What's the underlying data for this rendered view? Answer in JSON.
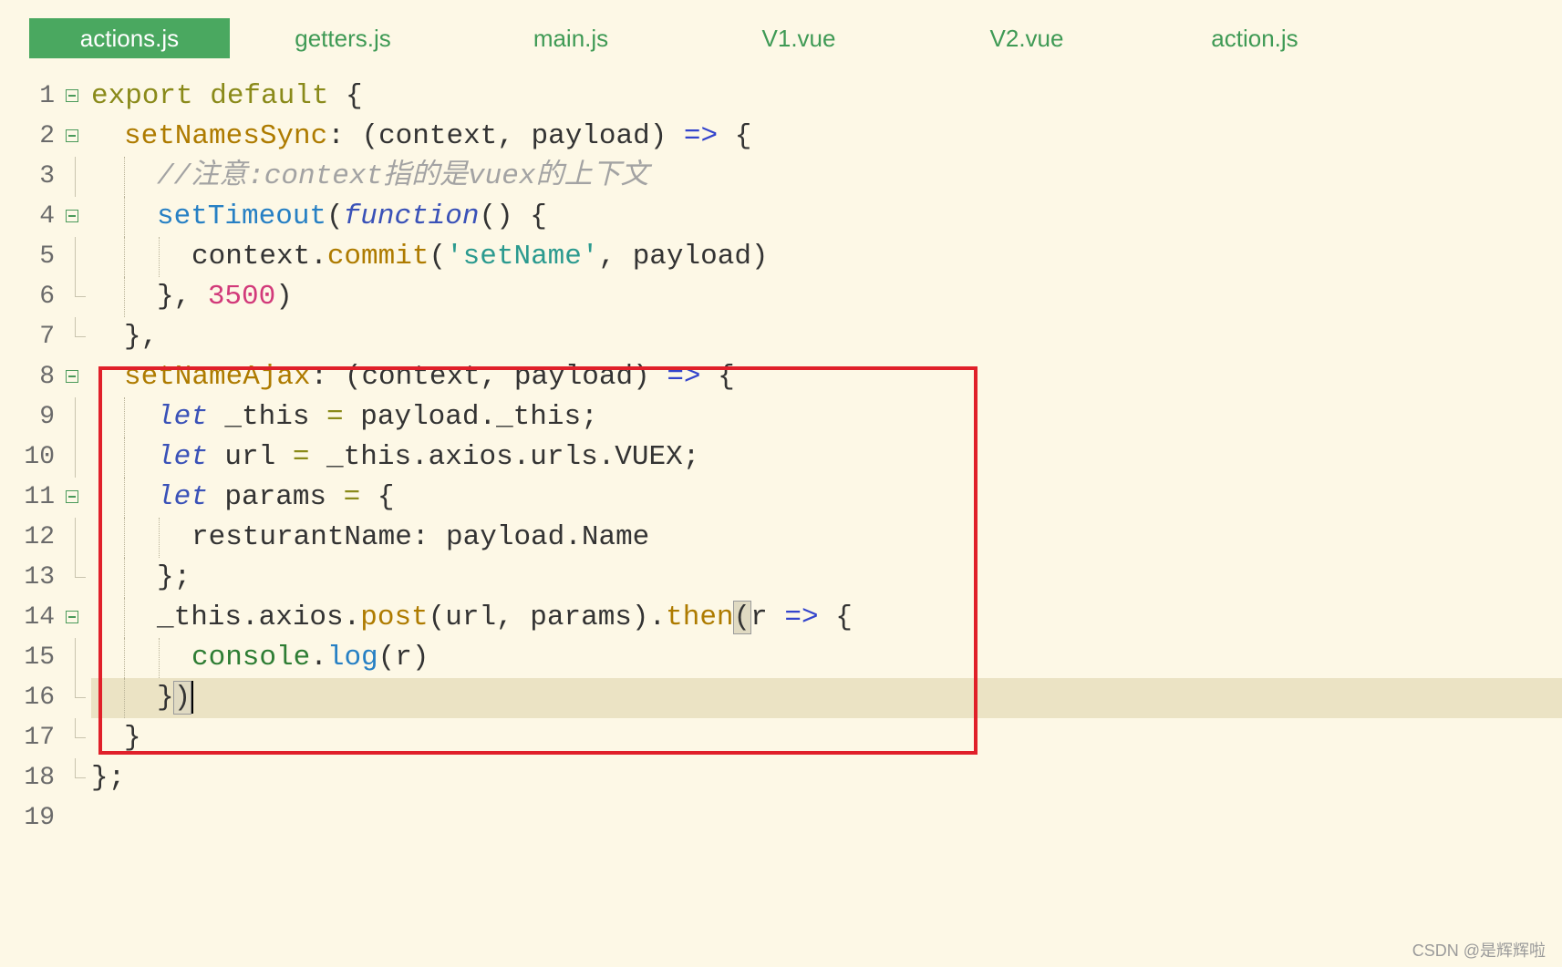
{
  "tabs": [
    {
      "label": "actions.js",
      "active": true
    },
    {
      "label": "getters.js"
    },
    {
      "label": "main.js"
    },
    {
      "label": "V1.vue"
    },
    {
      "label": "V2.vue"
    },
    {
      "label": "action.js"
    }
  ],
  "lines": {
    "n1": "1",
    "n2": "2",
    "n3": "3",
    "n4": "4",
    "n5": "5",
    "n6": "6",
    "n7": "7",
    "n8": "8",
    "n9": "9",
    "n10": "10",
    "n11": "11",
    "n12": "12",
    "n13": "13",
    "n14": "14",
    "n15": "15",
    "n16": "16",
    "n17": "17",
    "n18": "18",
    "n19": "19"
  },
  "tokens": {
    "export_default": "export default",
    "open_brace": " {",
    "setNamesSync": "setNamesSync",
    "colon": ":",
    "context_payload": " (context, payload) ",
    "arrow": "=>",
    "comment": "//注意:context指的是vuex的上下文",
    "setTimeout": "setTimeout",
    "paren_open": "(",
    "function": "function",
    "paren_close_brace": "() {",
    "context_dot": "context.",
    "commit": "commit",
    "str_setName": "'setName'",
    "comma_payload_close": ", payload)",
    "close_comma": "}, ",
    "num_3500": "3500",
    "paren_close": ")",
    "close_brace_comma": "},",
    "setNameAjax": "setNameAjax",
    "let": "let",
    "this_assign": " _this ",
    "eq": "=",
    "payload_this": " payload._this;",
    "url_assign": " url ",
    "this_axios_urls": " _this.axios.urls.VUEX;",
    "params_assign": " params ",
    "params_open": " {",
    "resturant": "resturantName: payload.Name",
    "close_semicolon": "};",
    "this_axios": "_this.axios.",
    "post": "post",
    "url_params": "(url, params).",
    "then": "then",
    "r_sp": "r ",
    "console": "console",
    "dot": ".",
    "log": "log",
    "r_paren": "(r)",
    "close_curly": "}",
    "close_paren": ")",
    "final_close": "};"
  },
  "watermark": "CSDN @是辉辉啦"
}
